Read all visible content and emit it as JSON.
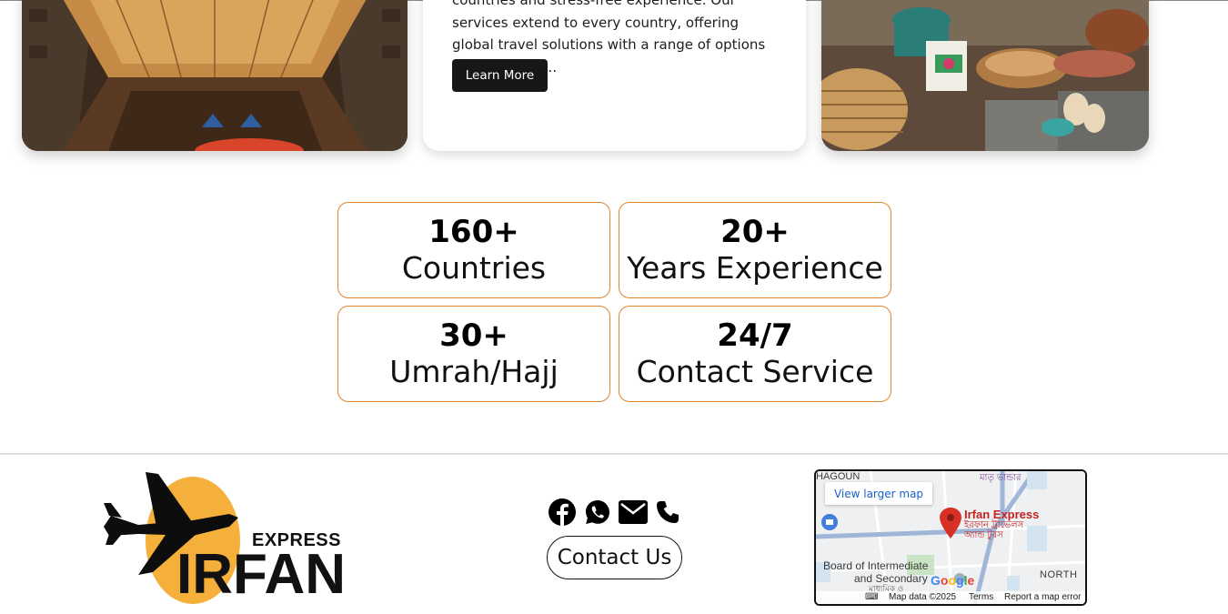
{
  "services": {
    "card_text": "countries and stress-free experience. Our services extend to every country, offering global travel solutions with a range of options to suit differe…",
    "learn_more_label": "Learn More"
  },
  "stats": [
    {
      "value": "160+",
      "label": "Countries"
    },
    {
      "value": "20+",
      "label": "Years Experience"
    },
    {
      "value": "30+",
      "label": "Umrah/Hajj"
    },
    {
      "value": "24/7",
      "label": "Contact Service"
    }
  ],
  "footer": {
    "logo_small": "EXPRESS",
    "logo_large": "IRFAN",
    "social_icons": [
      "facebook-icon",
      "whatsapp-icon",
      "email-icon",
      "phone-icon"
    ],
    "contact_label": "Contact Us",
    "map": {
      "view_larger": "View larger map",
      "place_name": "Irfan Express",
      "place_name_bn": "ইরফান ট্রাভেলস অ্যান্ড টুরস",
      "label_top": "HAGOUN",
      "label_top_bn": "মাতৃ ভান্ডার",
      "label_board": "Board of Intermediate",
      "label_board2": "and Secondary",
      "label_board_bn": "মাধ্যমিক ও",
      "label_north": "NORTH",
      "google_logo": "Google",
      "attribution": "Map data ©2025",
      "terms": "Terms",
      "report": "Report a map error"
    }
  },
  "colors": {
    "stat_border": "#e0842c",
    "button_dark": "#17171a",
    "logo_sun": "#f4b03a",
    "map_pin": "#d93025"
  }
}
